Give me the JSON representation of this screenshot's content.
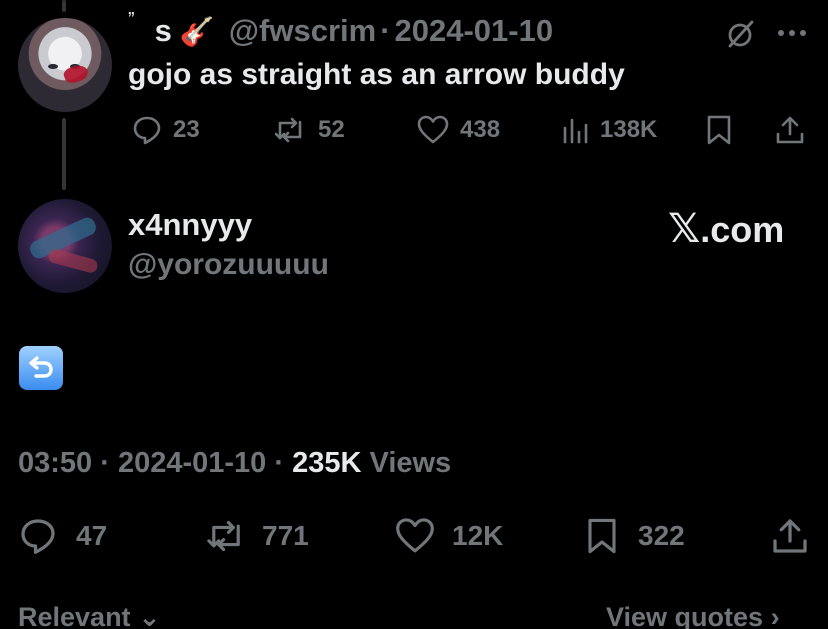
{
  "reply": {
    "author_name": "s",
    "author_prefix": "ˮ",
    "author_emoji": "🎸",
    "handle": "@fwscrim",
    "separator": "·",
    "date": "2024-01-10",
    "text": "gojo as straight as an arrow buddy",
    "actions": {
      "replies": "23",
      "reposts": "52",
      "likes": "438",
      "views": "138K"
    }
  },
  "main": {
    "author_name": "x4nnyyy",
    "handle": "@yorozuuuuu",
    "watermark_logo": "𝕏",
    "watermark_text": ".com",
    "content_emoji": "↩",
    "meta": {
      "time": "03:50",
      "separator": "·",
      "date": "2024-01-10",
      "views_count": "235K",
      "views_label": "Views"
    },
    "actions": {
      "replies": "47",
      "reposts": "771",
      "likes": "12K",
      "bookmarks": "322"
    }
  },
  "footer": {
    "sort_label": "Relevant",
    "sort_chevron": "⌄",
    "view_quotes_label": "View quotes",
    "view_quotes_chevron": "›"
  },
  "colors": {
    "background": "#000000",
    "primary_text": "#e7e9ea",
    "secondary_text": "#71767b",
    "thread_line": "#333639"
  }
}
